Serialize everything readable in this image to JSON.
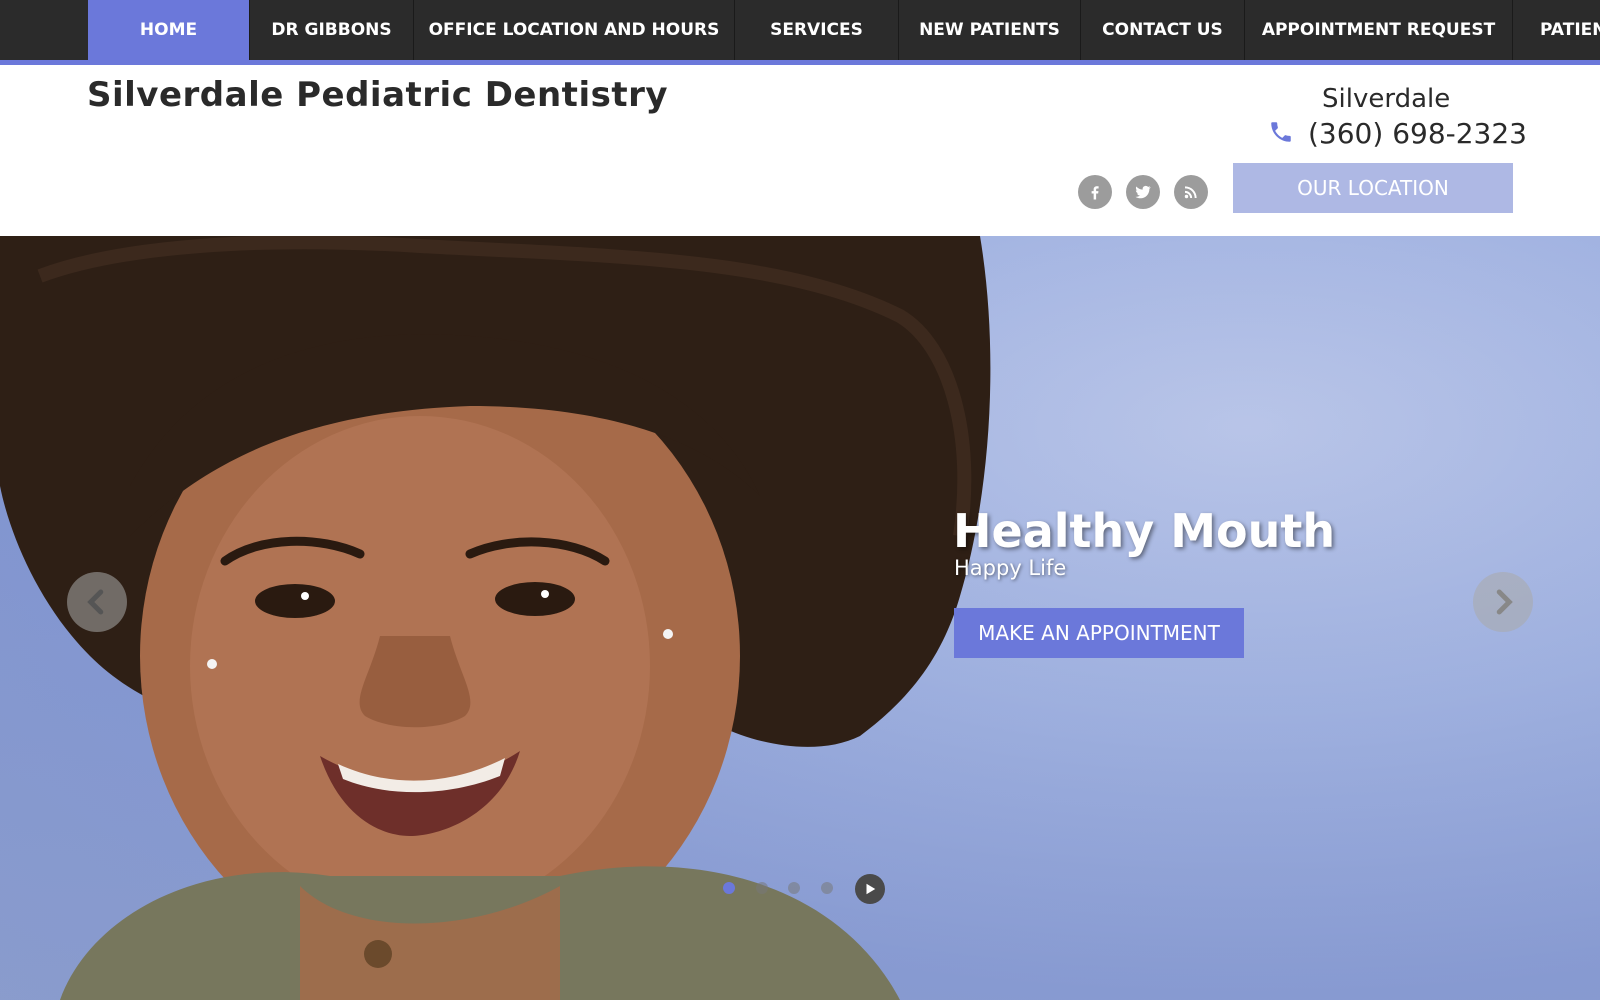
{
  "nav": {
    "items": [
      {
        "label": "HOME",
        "active": true
      },
      {
        "label": "DR GIBBONS",
        "active": false
      },
      {
        "label": "OFFICE LOCATION AND HOURS",
        "active": false
      },
      {
        "label": "SERVICES",
        "active": false
      },
      {
        "label": "NEW PATIENTS",
        "active": false
      },
      {
        "label": "CONTACT US",
        "active": false
      },
      {
        "label": "APPOINTMENT REQUEST",
        "active": false
      },
      {
        "label": "PATIEN",
        "active": false
      }
    ]
  },
  "header": {
    "site_title": "Silverdale Pediatric Dentistry",
    "location_name": "Silverdale",
    "phone": "(360) 698-2323",
    "our_location_label": "OUR LOCATION",
    "social_icons": [
      "facebook-icon",
      "twitter-icon",
      "rss-icon"
    ]
  },
  "hero": {
    "title": "Healthy Mouth",
    "subtitle": "Happy Life",
    "cta_label": "MAKE AN APPOINTMENT",
    "slide_count": 4,
    "active_slide": 1
  },
  "colors": {
    "accent": "#6b78da",
    "nav_bg": "#2b2b2b",
    "location_button": "#aeb8e4",
    "social_icon": "#9c9c9c"
  }
}
